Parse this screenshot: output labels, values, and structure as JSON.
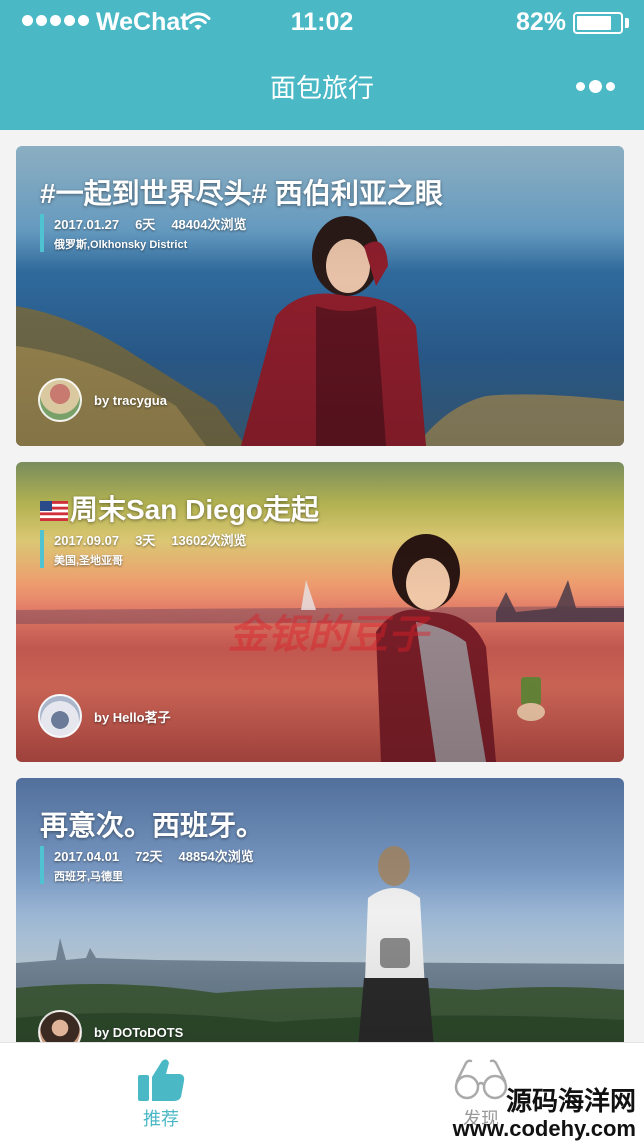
{
  "status_bar": {
    "carrier": "WeChat",
    "time": "11:02",
    "battery_percent": "82%",
    "battery_level": 0.82
  },
  "nav": {
    "title": "面包旅行"
  },
  "trips": [
    {
      "title": "#一起到世界尽头# 西伯利亚之眼",
      "date": "2017.01.27",
      "days": "6天",
      "views": "48404次浏览",
      "location": "俄罗斯,Olkhonsky District",
      "author": "by tracygua"
    },
    {
      "title": "周末San Diego走起",
      "flag": "flag-us-icon",
      "date": "2017.09.07",
      "days": "3天",
      "views": "13602次浏览",
      "location": "美国,圣地亚哥",
      "author": "by Hello茗子",
      "overlay_text": "金银的豆子"
    },
    {
      "title": "再意次。西班牙。",
      "date": "2017.04.01",
      "days": "72天",
      "views": "48854次浏览",
      "location": "西班牙,马德里",
      "author": "by DOToDOTS"
    }
  ],
  "tabbar": {
    "items": [
      {
        "label": "推荐",
        "icon": "thumbs-up-icon",
        "active": true
      },
      {
        "label": "发现",
        "icon": "glasses-icon",
        "active": false
      }
    ],
    "accent_color": "#4bb8c6"
  },
  "watermark": {
    "line1": "源码海洋网",
    "line2": "www.codehy.com"
  }
}
